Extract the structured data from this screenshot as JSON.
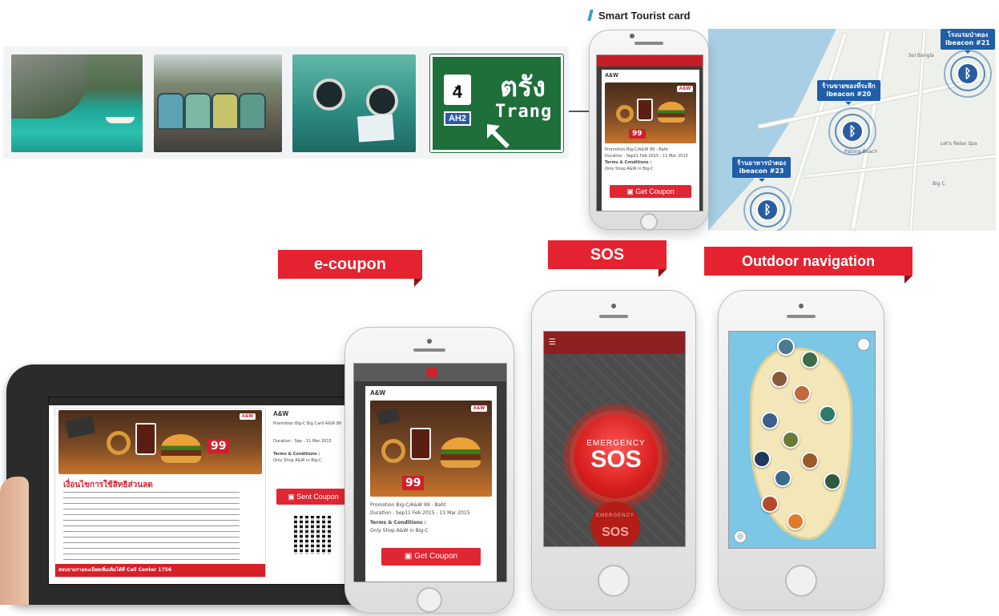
{
  "photo_strip": {
    "sign_route_number": "4",
    "sign_ah_code": "AH2",
    "sign_thai_name": "ตรัง",
    "sign_english_name": "Trang"
  },
  "smart_tourist_card": {
    "title": "Smart Tourist card",
    "beacons": [
      {
        "name": "โรงแรมป่าตอง",
        "id": "ibeacon #21"
      },
      {
        "name": "ร้านขายของที่ระลึก",
        "id": "ibeacon #20"
      },
      {
        "name": "ร้านอาหารป่าตอง",
        "id": "ibeacon #23"
      }
    ],
    "beacon_icon": "bluetooth-icon",
    "map_labels": [
      "Patong Beach",
      "Let's Relax Spa",
      "Big C",
      "Soi Bangla"
    ]
  },
  "coupon": {
    "brand": "A&W",
    "price_text": "99",
    "promotion": "Promotion Big-C/A&W 99 - Baht",
    "duration": "Duration : Sep11 Feb 2015 - 11 Mar 2015",
    "terms_title": "Terms & Conditions :",
    "terms_text": "Only Shop A&W in Big-C",
    "button_label": "Get Coupon"
  },
  "banners": {
    "ecoupon": "e-coupon",
    "sos": "SOS",
    "outdoor": "Outdoor navigation"
  },
  "tablet": {
    "brand": "A&W",
    "promo_short": "Promotion Big-C Big Card A&W 99",
    "duration": "Duration : Sep - 11 Mar 2015",
    "terms_title": "Terms & Conditions :",
    "terms_text": "Only Shop A&W in Big-C",
    "button_label": "Sent Coupon",
    "thai_heading": "เงื่อนไขการใช้สิทธิส่วนลด",
    "footer_text": "สอบถามรายละเอียดเพิ่มเติมได้ที่ Call Center 1756",
    "price_text": "99"
  },
  "sos_screen": {
    "emergency_label": "EMERGENCY",
    "sos_label": "SOS"
  },
  "colors": {
    "banner_red": "#e52330",
    "beacon_blue": "#1f5ea8",
    "coupon_button": "#e02633",
    "sign_green": "#1f6f3b"
  }
}
